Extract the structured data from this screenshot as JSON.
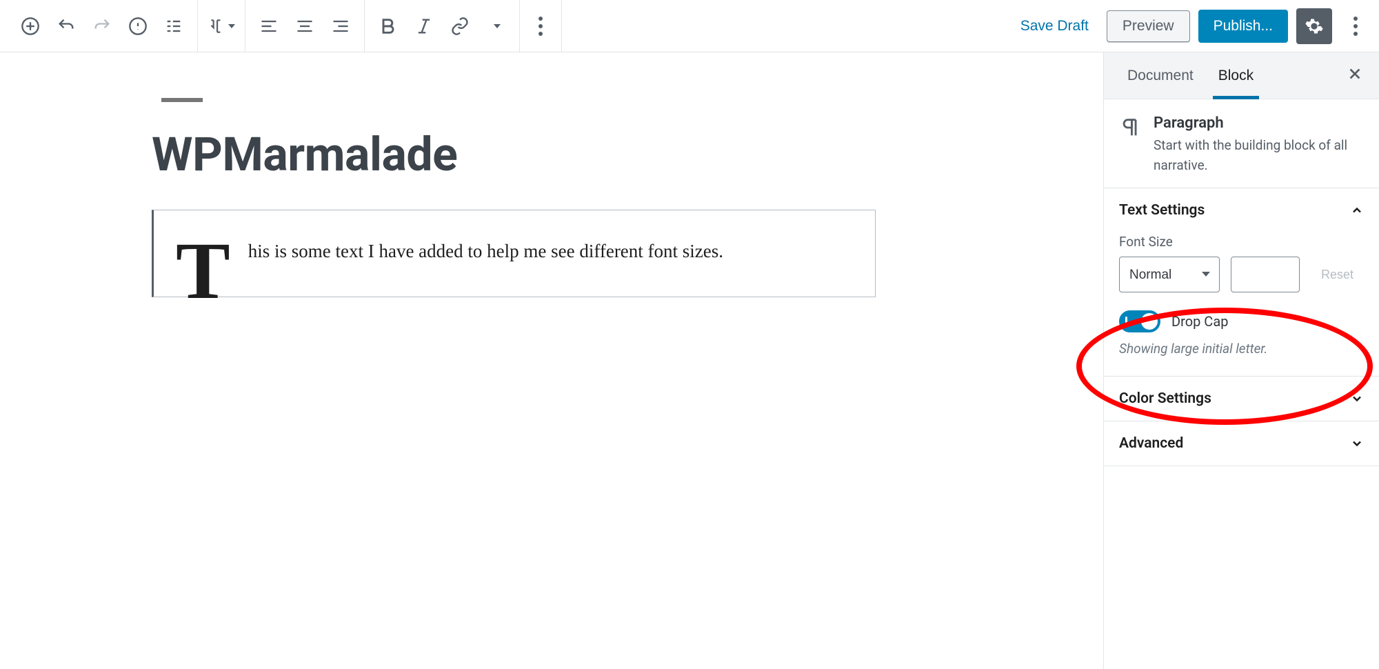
{
  "topbar": {
    "save_draft": "Save Draft",
    "preview": "Preview",
    "publish": "Publish..."
  },
  "post": {
    "title": "WPMarmalade",
    "paragraph_dropcap": "T",
    "paragraph_rest": "his is some text I have added to help me see different font sizes."
  },
  "sidebar": {
    "tabs": {
      "document": "Document",
      "block": "Block",
      "active": "block"
    },
    "block_info": {
      "title": "Paragraph",
      "description": "Start with the building block of all narrative."
    },
    "text_settings": {
      "title": "Text Settings",
      "font_size_label": "Font Size",
      "font_size_value": "Normal",
      "custom_size_value": "",
      "reset_label": "Reset",
      "drop_cap_label": "Drop Cap",
      "drop_cap_on": true,
      "drop_cap_help": "Showing large initial letter."
    },
    "color_settings": {
      "title": "Color Settings"
    },
    "advanced": {
      "title": "Advanced"
    }
  }
}
